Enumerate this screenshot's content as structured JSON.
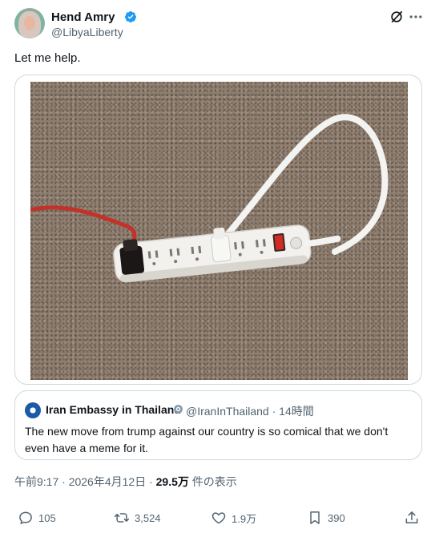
{
  "author": {
    "name": "Hend Amry",
    "handle": "@LibyaLiberty"
  },
  "tweet": {
    "text": "Let me help."
  },
  "quoted": {
    "name": "Iran Embassy in Thailand",
    "handle_time": "@IranInThailand · 14時間",
    "text": "The new move from trump against our country is so comical that we don't even have a meme for it."
  },
  "meta": {
    "time_date": "午前9:17 · 2026年4月12日 · ",
    "views_count": "29.5万",
    "views_suffix": " 件の表示"
  },
  "actions": {
    "replies": "105",
    "retweets": "3,524",
    "likes": "1.9万",
    "bookmarks": "390"
  },
  "icons": {
    "verified": "verified-badge-icon",
    "grok": "grok-icon",
    "more": "more-icon",
    "reply": "reply-icon",
    "retweet": "retweet-icon",
    "like": "like-icon",
    "bookmark": "bookmark-icon",
    "share": "share-icon"
  },
  "colors": {
    "verified_blue": "#1d9bf0",
    "secondary_text": "#536471",
    "border": "#cfd9de"
  }
}
